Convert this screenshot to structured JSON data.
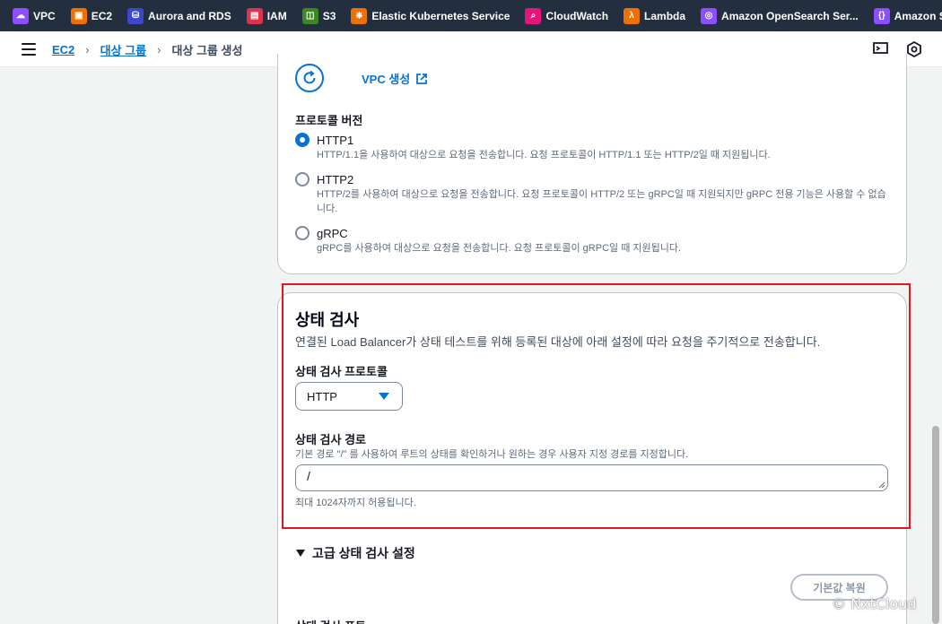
{
  "service_bar": {
    "items": [
      {
        "label": "VPC",
        "icon": "vpc-icon",
        "color": "#8c4fff"
      },
      {
        "label": "EC2",
        "icon": "ec2-icon",
        "color": "#ed7100"
      },
      {
        "label": "Aurora and RDS",
        "icon": "rds-icon",
        "color": "#3b48cc"
      },
      {
        "label": "IAM",
        "icon": "iam-icon",
        "color": "#dd344c"
      },
      {
        "label": "S3",
        "icon": "s3-icon",
        "color": "#3f8624"
      },
      {
        "label": "Elastic Kubernetes Service",
        "icon": "eks-icon",
        "color": "#ed7100"
      },
      {
        "label": "CloudWatch",
        "icon": "cloudwatch-icon",
        "color": "#e7157b"
      },
      {
        "label": "Lambda",
        "icon": "lambda-icon",
        "color": "#ed7100"
      },
      {
        "label": "Amazon OpenSearch Ser...",
        "icon": "opensearch-icon",
        "color": "#8c4fff"
      },
      {
        "label": "Amazon Sa",
        "icon": "sagemaker-icon",
        "color": "#8c4fff"
      }
    ]
  },
  "breadcrumb": {
    "items": [
      "EC2",
      "대상 그룹"
    ],
    "current": "대상 그룹 생성"
  },
  "vpc_link": "VPC 생성",
  "protocol_version": {
    "label": "프로토콜 버전",
    "options": [
      {
        "title": "HTTP1",
        "desc": "HTTP/1.1을 사용하여 대상으로 요청을 전송합니다. 요청 프로토콜이 HTTP/1.1 또는 HTTP/2일 때 지원됩니다.",
        "selected": true
      },
      {
        "title": "HTTP2",
        "desc": "HTTP/2를 사용하여 대상으로 요청을 전송합니다. 요청 프로토콜이 HTTP/2 또는 gRPC일 때 지원되지만 gRPC 전용 기능은 사용할 수 없습니다.",
        "selected": false
      },
      {
        "title": "gRPC",
        "desc": "gRPC를 사용하여 대상으로 요청을 전송합니다. 요청 프로토콜이 gRPC일 때 지원됩니다.",
        "selected": false
      }
    ]
  },
  "health_check": {
    "title": "상태 검사",
    "description": "연결된 Load Balancer가 상태 테스트를 위해 등록된 대상에 아래 설정에 따라 요청을 주기적으로 전송합니다.",
    "protocol_label": "상태 검사 프로토콜",
    "protocol_value": "HTTP",
    "path_label": "상태 검사 경로",
    "path_desc": "기본 경로 \"/\" 를 사용하여 루트의 상태를 확인하거나 원하는 경우 사용자 지정 경로를 지정합니다.",
    "path_value": "/",
    "path_hint": "최대 1024자까지 허용됩니다."
  },
  "advanced": {
    "label": "고급 상태 검사 설정",
    "reset_label": "기본값 복원",
    "next_label": "상태 검사 포트"
  },
  "watermark": "© NxtCloud",
  "colors": {
    "accent": "#0972d3",
    "highlight": "#d91a20",
    "topbar": "#232f3e"
  }
}
